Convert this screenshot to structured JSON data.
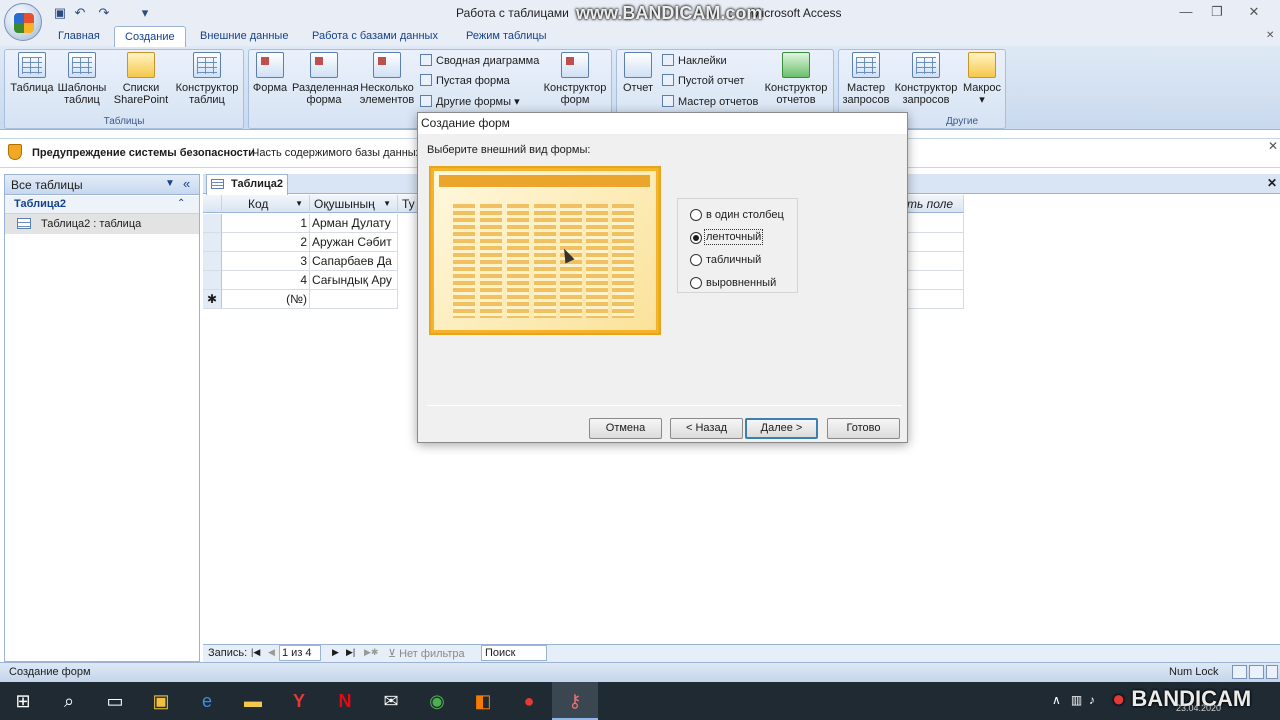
{
  "window": {
    "title": "Работа с таблицами",
    "app_name": "Microsoft Access",
    "title_suffix": "2007) - Microsoft Access"
  },
  "tabs": [
    "Главная",
    "Создание",
    "Внешние данные",
    "Работа с базами данных",
    "Режим таблицы"
  ],
  "active_tab": "Создание",
  "ribbon": {
    "tables": {
      "label": "Таблицы",
      "buttons": [
        "Таблица",
        "Шаблоны\nтаблиц",
        "Списки\nSharePoint",
        "Конструктор\nтаблиц"
      ]
    },
    "forms": {
      "buttons": [
        "Форма",
        "Разделенная\nформа",
        "Несколько\nэлементов"
      ],
      "small": [
        "Сводная диаграмма",
        "Пустая форма",
        "Другие формы"
      ],
      "designer": "Конструктор\nформ"
    },
    "reports": {
      "report": "Отчет",
      "small": [
        "Наклейки",
        "Пустой отчет",
        "Мастер отчетов"
      ],
      "designer": "Конструктор\nотчетов"
    },
    "other": {
      "label": "Другие",
      "buttons": [
        "Мастер\nзапросов",
        "Конструктор\nзапросов",
        "Макрос"
      ]
    }
  },
  "security": {
    "title": "Предупреждение системы безопасности",
    "text": "Часть содержимого базы данных"
  },
  "nav": {
    "header": "Все таблицы",
    "group": "Таблица2",
    "item": "Таблица2 : таблица"
  },
  "document": {
    "tab": "Таблица2",
    "columns": [
      "Код",
      "Оқушының",
      "Ту",
      "ть поле"
    ],
    "rows": [
      {
        "id": "1",
        "name": "Арман Дулату"
      },
      {
        "id": "2",
        "name": "Аружан Сәбит"
      },
      {
        "id": "3",
        "name": "Сапарбаев Да"
      },
      {
        "id": "4",
        "name": "Сағындық Ару"
      }
    ],
    "new_row": "(№)"
  },
  "record_nav": {
    "label": "Запись:",
    "position": "1 из 4",
    "filter": "Нет фильтра",
    "search": "Поиск"
  },
  "status": {
    "text": "Создание форм",
    "numlock": "Num Lock"
  },
  "dialog": {
    "title": "Создание форм",
    "prompt": "Выберите внешний вид формы:",
    "options": [
      "в один столбец",
      "ленточный",
      "табличный",
      "выровненный"
    ],
    "selected": "ленточный",
    "buttons": {
      "cancel": "Отмена",
      "back": "< Назад",
      "next": "Далее >",
      "finish": "Готово"
    }
  },
  "watermark": {
    "top": "www.BANDICAM.com",
    "bottom": "BANDICAM",
    "date": "23.04.2020"
  },
  "colors": {
    "ribbon": "#dfe9f5",
    "accent": "#15428b",
    "preview": "#f5b32a"
  }
}
